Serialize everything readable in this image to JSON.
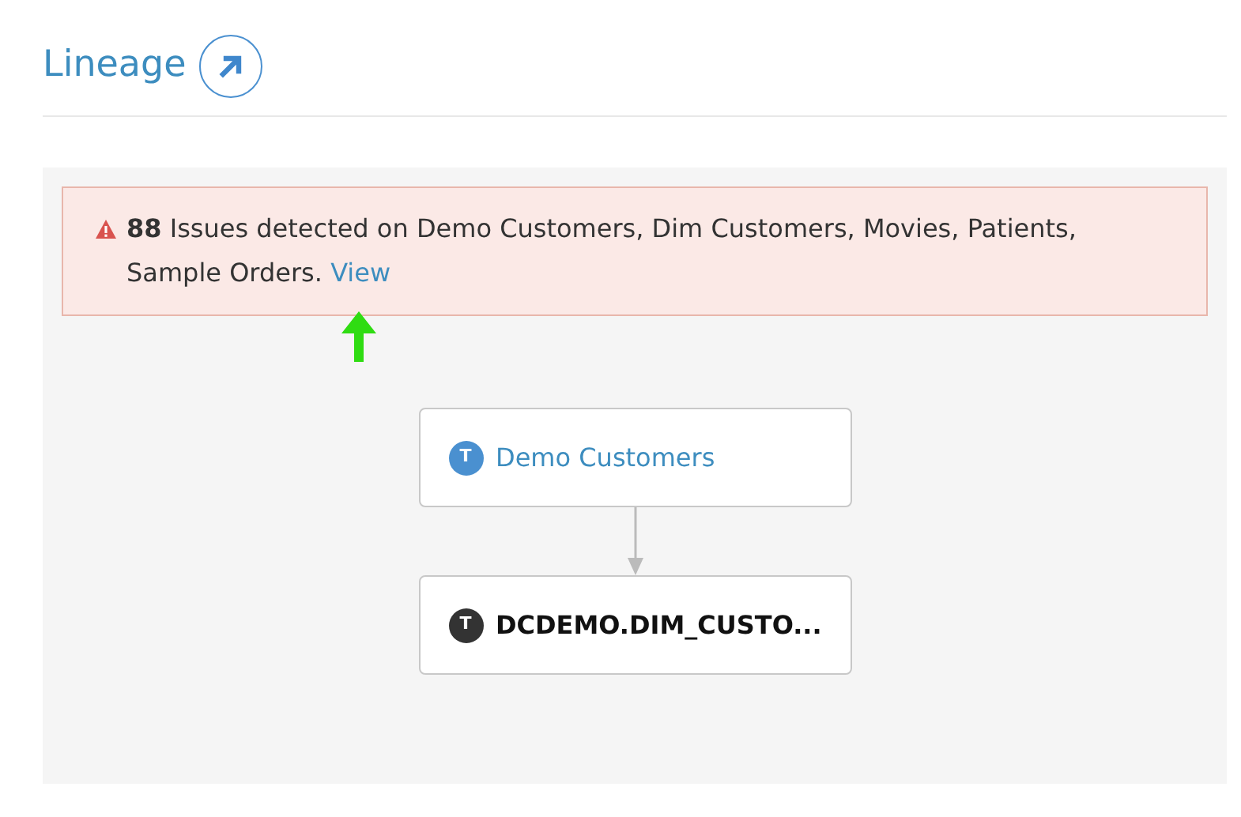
{
  "heading": {
    "title": "Lineage"
  },
  "alert": {
    "message": "**88** Issues detected on Demo Customers, Dim Customers, Movies, Patients, Sample Orders.",
    "link": "View"
  },
  "nodes": [
    {
      "badge": "T",
      "label": "Demo Customers",
      "selected": false
    },
    {
      "badge": "T",
      "label": "DCDEMO.DIM_CUSTO...",
      "selected": true
    }
  ]
}
